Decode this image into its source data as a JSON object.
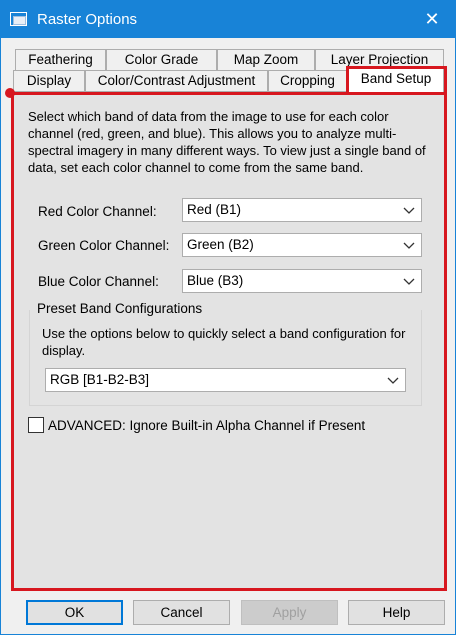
{
  "window": {
    "title": "Raster Options",
    "close_glyph": "✕"
  },
  "tabs_row1": [
    "Feathering",
    "Color Grade",
    "Map Zoom",
    "Layer Projection"
  ],
  "tabs_row2": [
    "Display",
    "Color/Contrast Adjustment",
    "Cropping",
    "Band Setup"
  ],
  "active_tab": "Band Setup",
  "description": "Select which band of data from the image to use for each color channel (red, green, and blue). This allows you to analyze multi-spectral imagery in many different ways. To view just a single band of data, set each color channel to come from the same band.",
  "channels": {
    "red": {
      "label": "Red Color Channel:",
      "value": "Red (B1)"
    },
    "green": {
      "label": "Green Color Channel:",
      "value": "Green (B2)"
    },
    "blue": {
      "label": "Blue Color Channel:",
      "value": "Blue (B3)"
    }
  },
  "preset": {
    "title": "Preset Band Configurations",
    "description": "Use the options below to quickly select a band configuration for display.",
    "value": "RGB [B1-B2-B3]"
  },
  "advanced": {
    "label": "ADVANCED: Ignore Built-in Alpha Channel if Present",
    "checked": false
  },
  "buttons": {
    "ok": "OK",
    "cancel": "Cancel",
    "apply": "Apply",
    "help": "Help"
  },
  "colors": {
    "titlebar": "#1883d7",
    "highlight": "#d7171f",
    "panel": "#e3e3e3"
  }
}
